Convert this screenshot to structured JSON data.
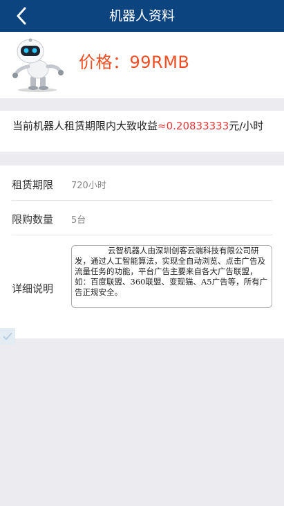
{
  "navbar": {
    "title": "机器人资料",
    "back_icon": "chevron-left-icon"
  },
  "product": {
    "image": "robot-mascot",
    "price_label": "价格：99RMB"
  },
  "income": {
    "prefix": "当前机器人租赁期限内大致收益",
    "value": "≈0.20833333",
    "suffix": "元/小时"
  },
  "details": {
    "rows": [
      {
        "label": "租赁期限",
        "value": "720小时"
      },
      {
        "label": "限购数量",
        "value": "5台"
      }
    ],
    "description_label": "详细说明",
    "description_text": "云智机器人由深圳创客云端科技有限公司研发，通过人工智能算法，实现全自动浏览、点击广告及流量任务的功能，平台广告主要来自各大广告联盟，如：百度联盟、360联盟、变现猫、A5广告等，所有广告正规安全。"
  },
  "colors": {
    "nav_bg": "#0c447f",
    "price": "#f04e23",
    "income_value": "#e83a3a",
    "page_bg": "#ebebf0"
  }
}
